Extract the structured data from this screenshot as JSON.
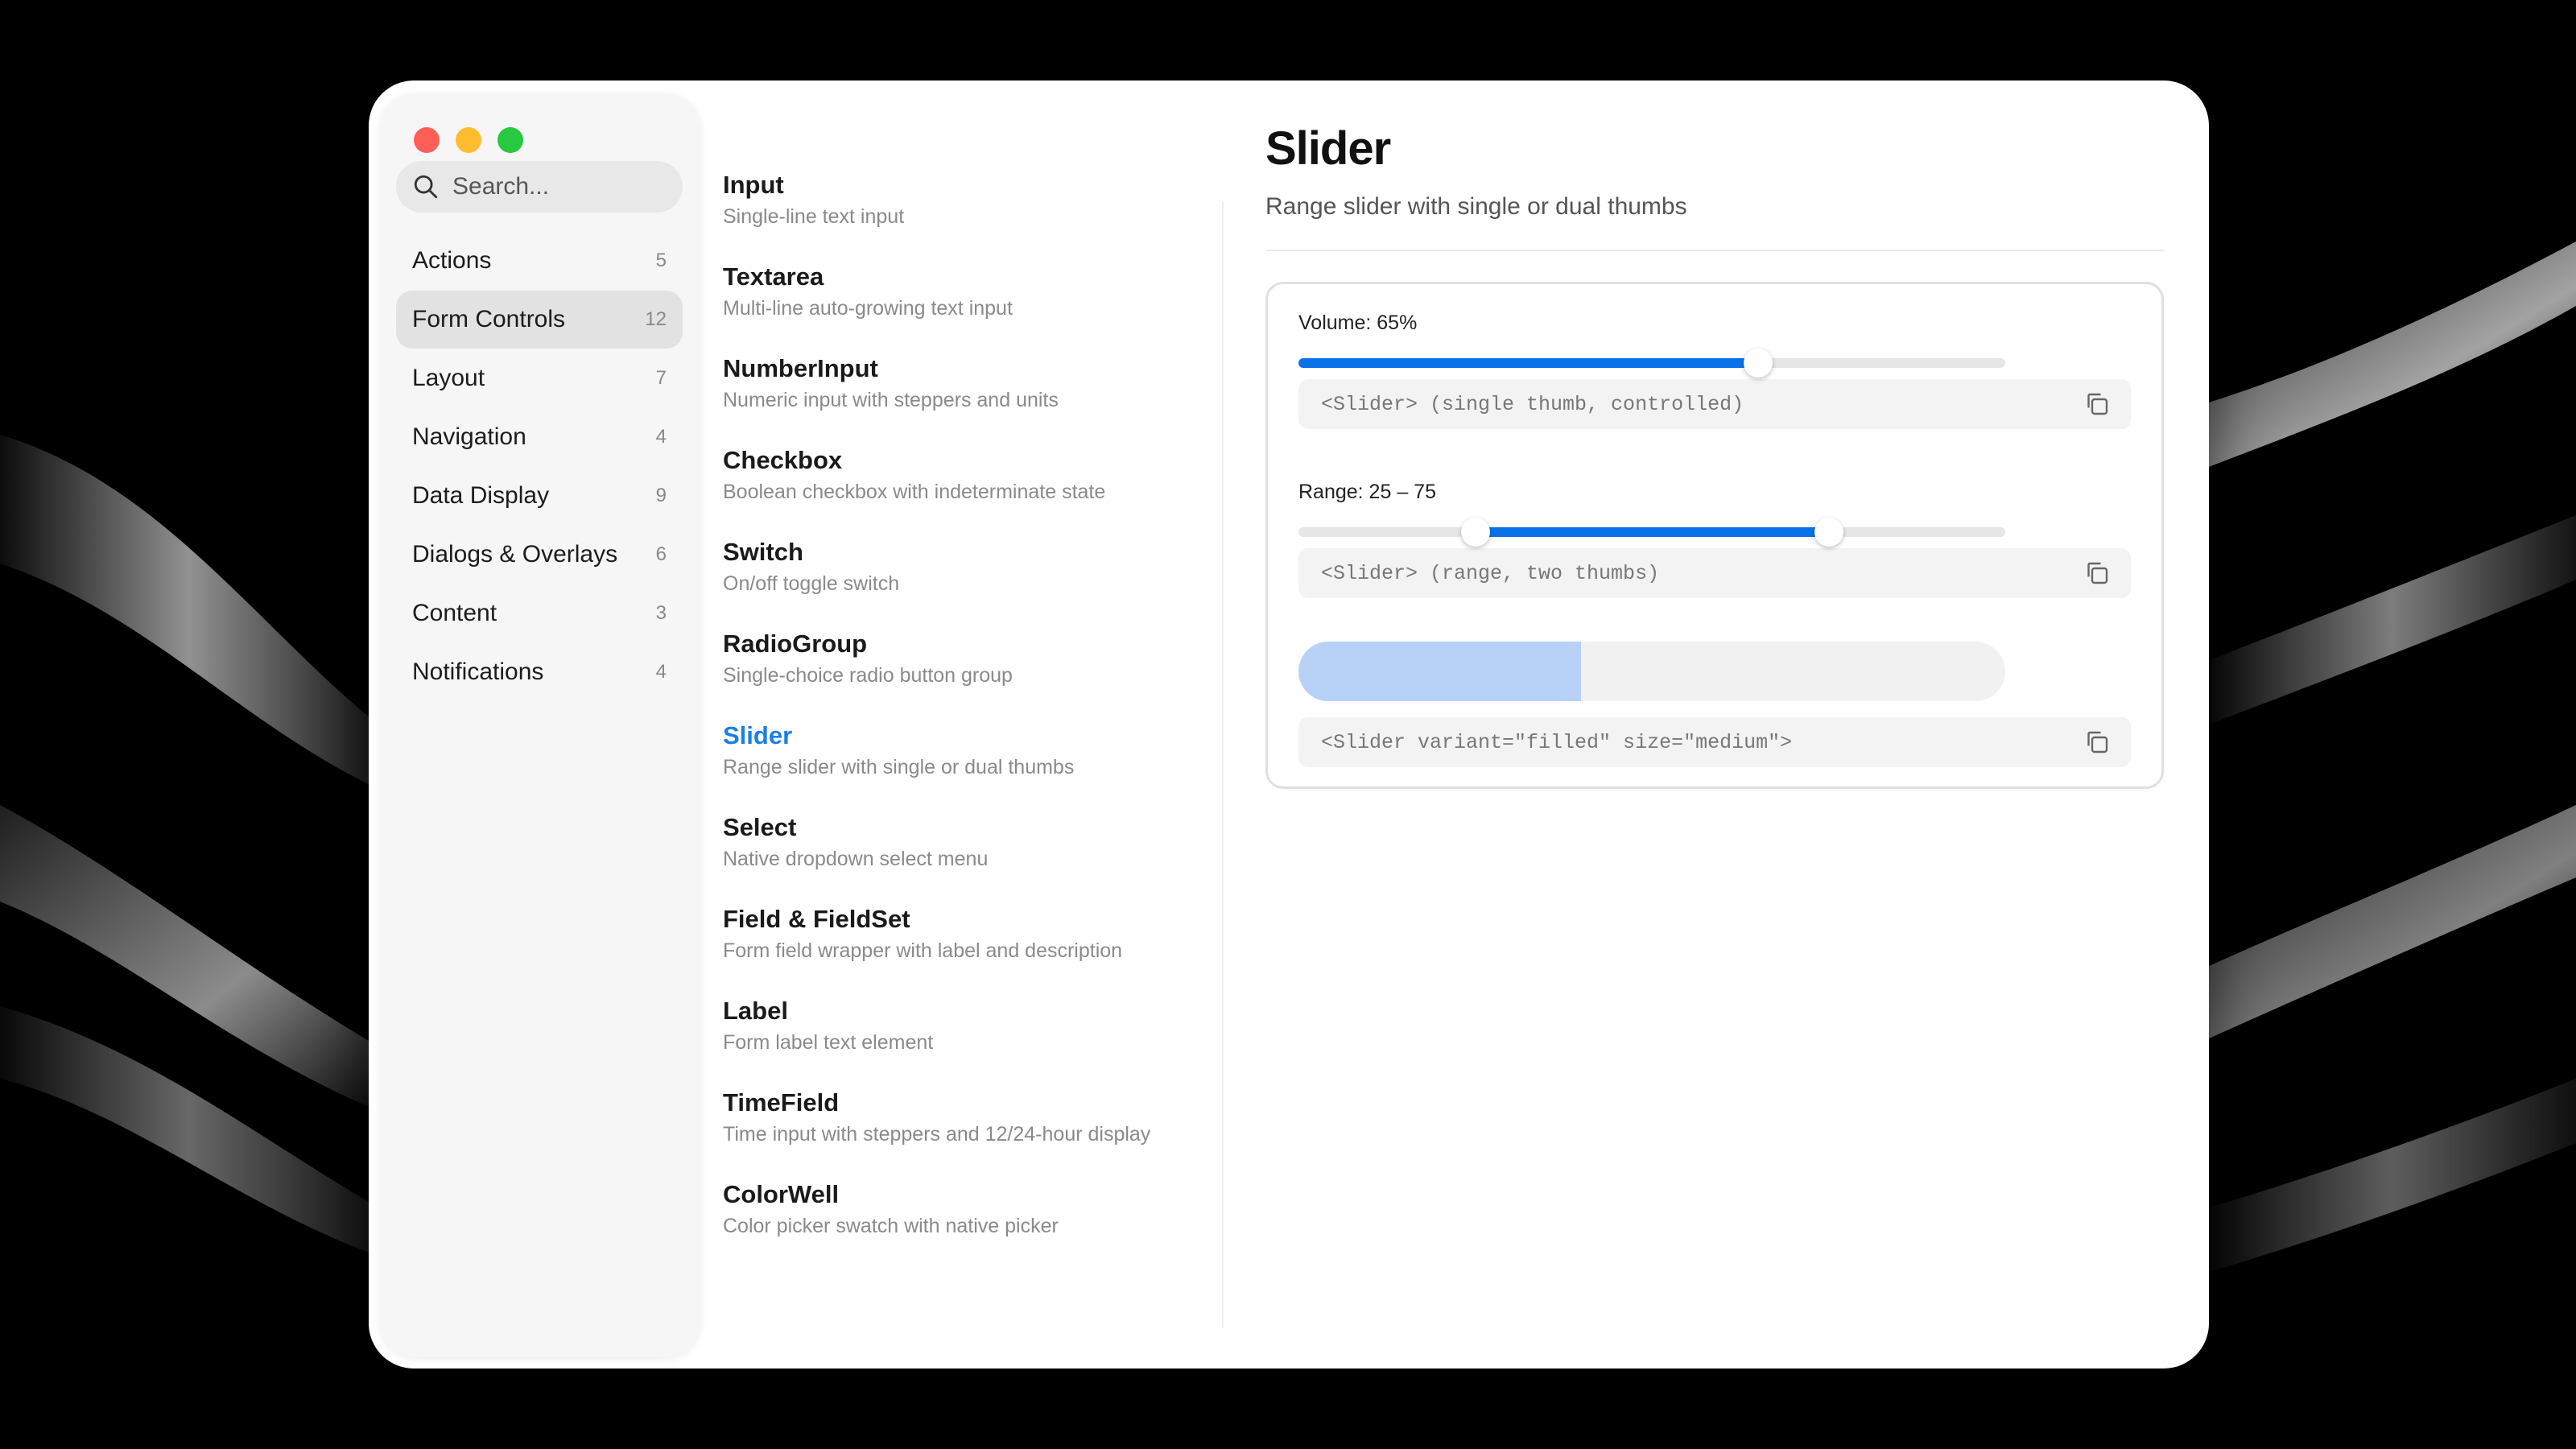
{
  "sidebar": {
    "search_placeholder": "Search...",
    "categories": [
      {
        "label": "Actions",
        "count": "5"
      },
      {
        "label": "Form Controls",
        "count": "12",
        "active": true
      },
      {
        "label": "Layout",
        "count": "7"
      },
      {
        "label": "Navigation",
        "count": "4"
      },
      {
        "label": "Data Display",
        "count": "9"
      },
      {
        "label": "Dialogs & Overlays",
        "count": "6"
      },
      {
        "label": "Content",
        "count": "3"
      },
      {
        "label": "Notifications",
        "count": "4"
      }
    ]
  },
  "components": [
    {
      "title": "Input",
      "desc": "Single-line text input"
    },
    {
      "title": "Textarea",
      "desc": "Multi-line auto-growing text input"
    },
    {
      "title": "NumberInput",
      "desc": "Numeric input with steppers and units"
    },
    {
      "title": "Checkbox",
      "desc": "Boolean checkbox with indeterminate state"
    },
    {
      "title": "Switch",
      "desc": "On/off toggle switch"
    },
    {
      "title": "RadioGroup",
      "desc": "Single-choice radio button group"
    },
    {
      "title": "Slider",
      "desc": "Range slider with single or dual thumbs",
      "active": true
    },
    {
      "title": "Select",
      "desc": "Native dropdown select menu"
    },
    {
      "title": "Field & FieldSet",
      "desc": "Form field wrapper with label and description"
    },
    {
      "title": "Label",
      "desc": "Form label text element"
    },
    {
      "title": "TimeField",
      "desc": "Time input with steppers and 12/24-hour display"
    },
    {
      "title": "ColorWell",
      "desc": "Color picker swatch with native picker"
    }
  ],
  "detail": {
    "title": "Slider",
    "subtitle": "Range slider with single or dual thumbs",
    "volume": {
      "label": "Volume: 65%",
      "value": 65,
      "code": "<Slider> (single thumb, controlled)"
    },
    "range": {
      "label": "Range: 25 – 75",
      "low": 25,
      "high": 75,
      "code": "<Slider> (range, two thumbs)"
    },
    "filled": {
      "value": 40,
      "code": "<Slider variant=\"filled\" size=\"medium\">"
    }
  },
  "colors": {
    "accent": "#0a72e8",
    "active_link": "#1a7fe6",
    "filled_slider": "#b8d1f7",
    "traffic_red": "#ff5f57",
    "traffic_yellow": "#febc2e",
    "traffic_green": "#28c840"
  }
}
